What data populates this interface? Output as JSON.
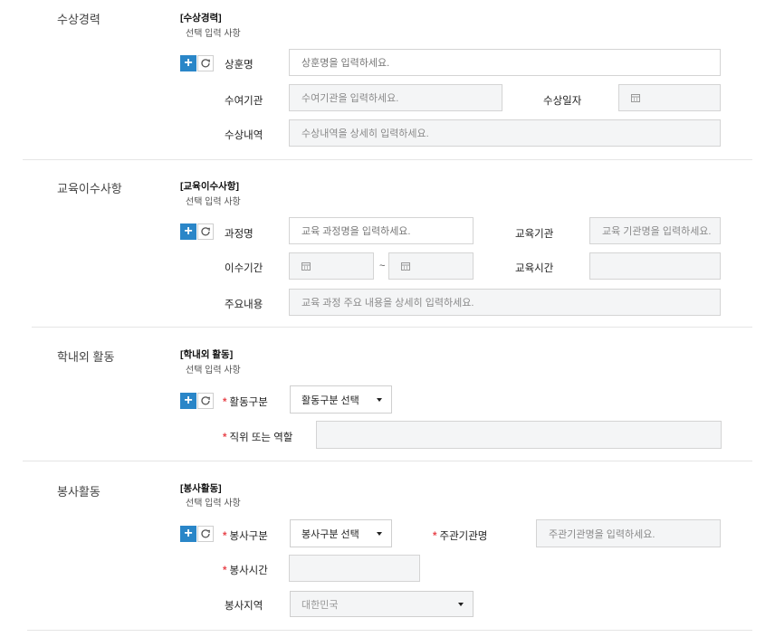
{
  "awards": {
    "title": "수상경력",
    "sub_title": "[수상경력]",
    "sub_note": "선택 입력 사항",
    "name_label": "상훈명",
    "name_placeholder": "상훈명을 입력하세요.",
    "org_label": "수여기관",
    "org_placeholder": "수여기관을 입력하세요.",
    "date_label": "수상일자",
    "detail_label": "수상내역",
    "detail_placeholder": "수상내역을 상세히 입력하세요."
  },
  "education": {
    "title": "교육이수사항",
    "sub_title": "[교육이수사항]",
    "sub_note": "선택 입력 사항",
    "course_label": "과정명",
    "course_placeholder": "교육 과정명을 입력하세요.",
    "inst_label": "교육기관",
    "inst_placeholder": "교육 기관명을 입력하세요.",
    "period_label": "이수기간",
    "period_sep": "~",
    "hours_label": "교육시간",
    "content_label": "주요내용",
    "content_placeholder": "교육 과정 주요 내용을 상세히 입력하세요."
  },
  "activities": {
    "title": "학내외 활동",
    "sub_title": "[학내외 활동]",
    "sub_note": "선택 입력 사항",
    "type_label": "활동구분",
    "type_select": "활동구분 선택",
    "role_label": "직위 또는 역할"
  },
  "volunteer": {
    "title": "봉사활동",
    "sub_title": "[봉사활동]",
    "sub_note": "선택 입력 사항",
    "type_label": "봉사구분",
    "type_select": "봉사구분 선택",
    "host_label": "주관기관명",
    "host_placeholder": "주관기관명을 입력하세요.",
    "time_label": "봉사시간",
    "region_label": "봉사지역",
    "region_select": "대한민국"
  },
  "common": {
    "required_mark": "*",
    "add_symbol": "+"
  },
  "colors": {
    "accent": "#2a86c8",
    "required": "#e8454c"
  }
}
